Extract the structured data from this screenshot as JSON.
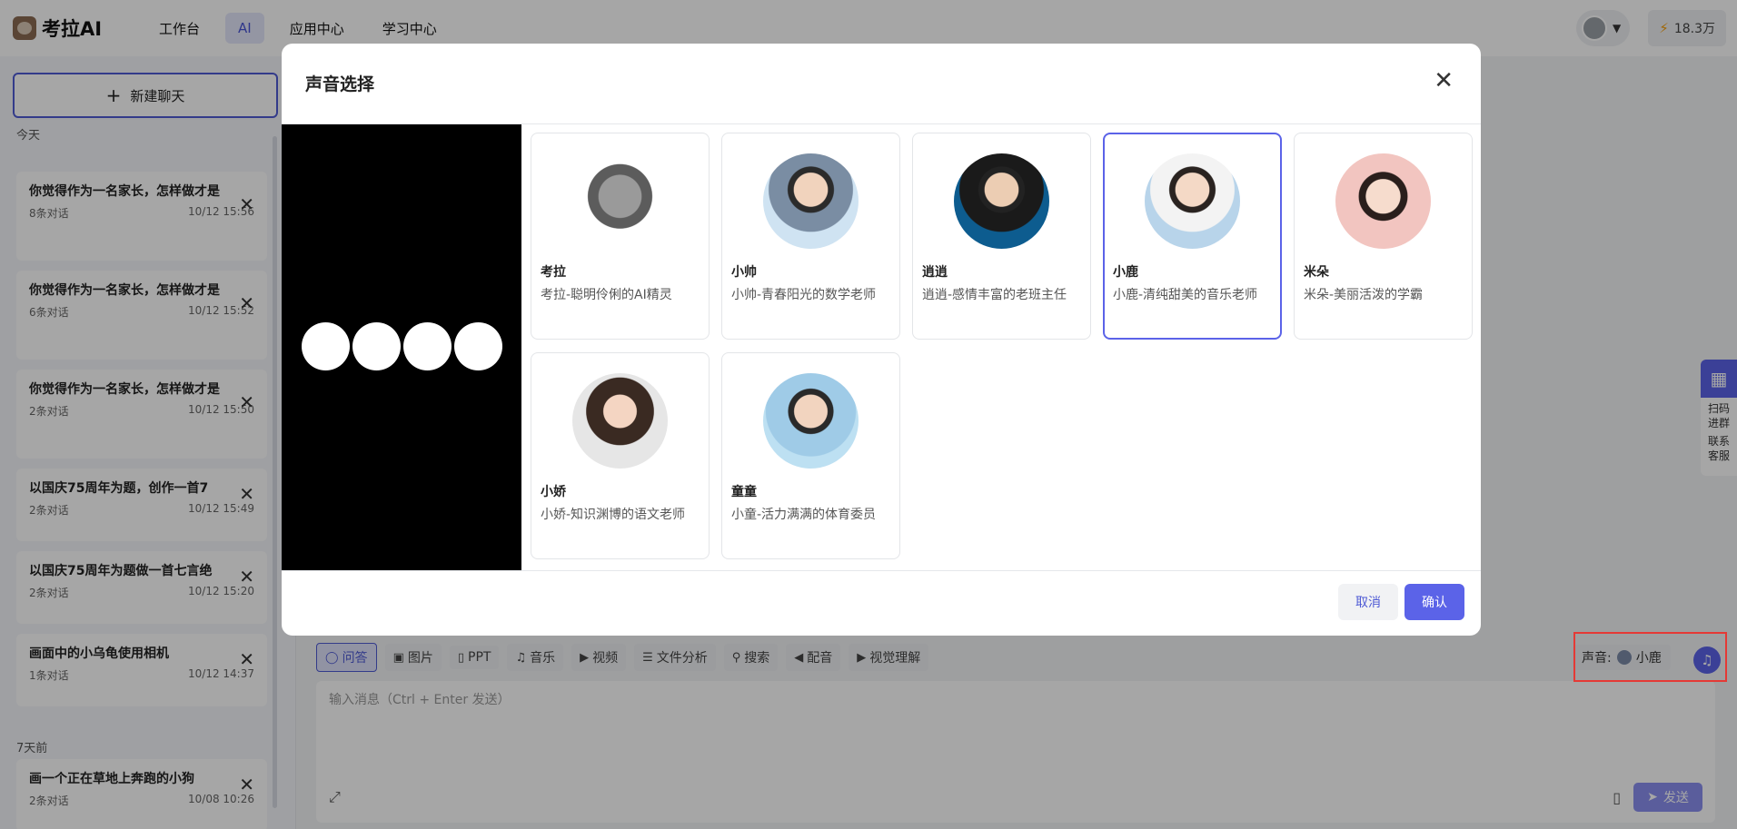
{
  "app": {
    "logo_text": "考拉AI",
    "nav": [
      "工作台",
      "AI",
      "应用中心",
      "学习中心"
    ],
    "points": "18.3万"
  },
  "sidebar": {
    "new_chat_label": "新建聊天",
    "group_today": "今天",
    "group_week": "7天前",
    "chats": [
      {
        "title": "你觉得作为一名家长，怎样做才是",
        "count": "8条对话",
        "time": "10/12 15:56"
      },
      {
        "title": "你觉得作为一名家长，怎样做才是",
        "count": "6条对话",
        "time": "10/12 15:52"
      },
      {
        "title": "你觉得作为一名家长，怎样做才是",
        "count": "2条对话",
        "time": "10/12 15:50"
      },
      {
        "title": "以国庆75周年为题，创作一首7",
        "count": "2条对话",
        "time": "10/12 15:49"
      },
      {
        "title": "以国庆75周年为题做一首七言绝",
        "count": "2条对话",
        "time": "10/12 15:20"
      },
      {
        "title": "画面中的小乌龟使用相机",
        "count": "1条对话",
        "time": "10/12 14:37"
      },
      {
        "title": "画一个正在草地上奔跑的小狗",
        "count": "2条对话",
        "time": "10/08 10:26"
      }
    ]
  },
  "toolbar": {
    "tools": [
      "问答",
      "图片",
      "PPT",
      "音乐",
      "视频",
      "文件分析",
      "搜索",
      "配音",
      "视觉理解"
    ],
    "voice_label": "声音:",
    "voice_value": "小鹿"
  },
  "input": {
    "placeholder": "输入消息（Ctrl + Enter 发送）",
    "send_label": "发送"
  },
  "side_tools": {
    "scan": "扫码进群",
    "service": "联系客服"
  },
  "modal": {
    "title": "声音选择",
    "selected_index": 3,
    "voices": [
      {
        "name": "考拉",
        "desc": "考拉-聪明伶俐的AI精灵"
      },
      {
        "name": "小帅",
        "desc": "小帅-青春阳光的数学老师"
      },
      {
        "name": "逍逍",
        "desc": "逍逍-感情丰富的老班主任"
      },
      {
        "name": "小鹿",
        "desc": "小鹿-清纯甜美的音乐老师"
      },
      {
        "name": "米朵",
        "desc": "米朵-美丽活泼的学霸"
      },
      {
        "name": "小娇",
        "desc": "小娇-知识渊博的语文老师"
      },
      {
        "name": "童童",
        "desc": "小童-活力满满的体育委员"
      }
    ],
    "cancel_label": "取消",
    "confirm_label": "确认"
  }
}
